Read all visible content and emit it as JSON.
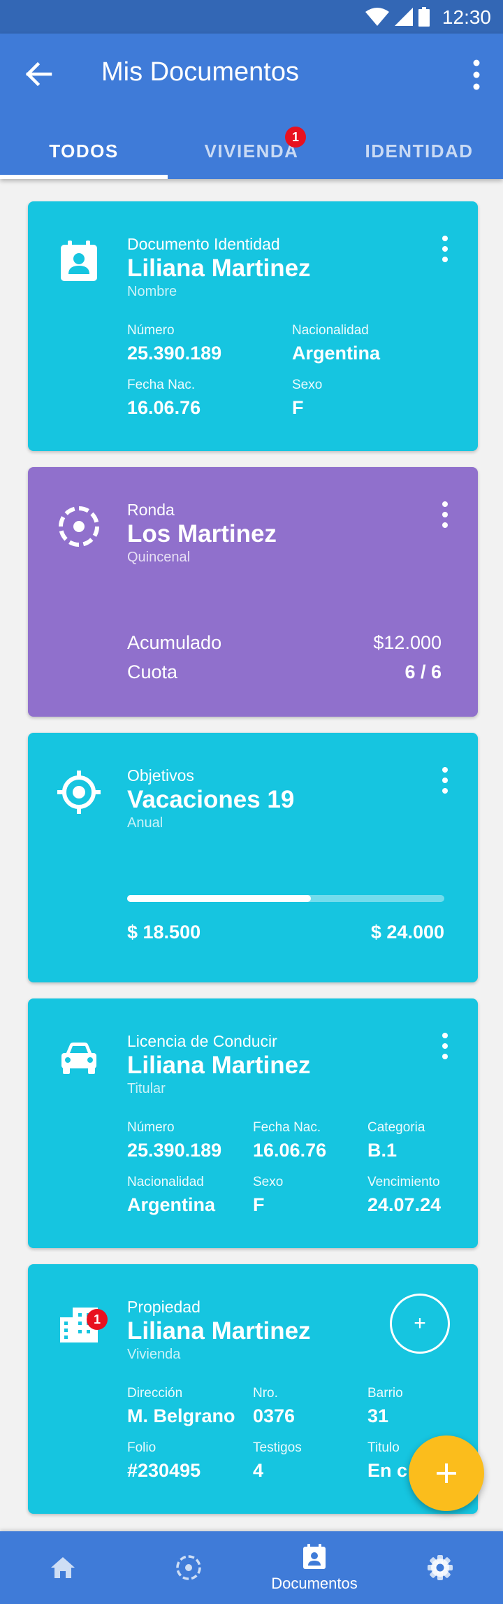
{
  "status_bar": {
    "time": "12:30"
  },
  "app_bar": {
    "title": "Mis Documentos"
  },
  "tabs": [
    {
      "label": "TODOS",
      "active": true
    },
    {
      "label": "VIVIENDA",
      "badge": "1"
    },
    {
      "label": "IDENTIDAD"
    }
  ],
  "cards": {
    "identity": {
      "overline": "Documento Identidad",
      "title": "Liliana Martinez",
      "subtitle": "Nombre",
      "fields": [
        {
          "label": "Número",
          "value": "25.390.189"
        },
        {
          "label": "Nacionalidad",
          "value": "Argentina"
        },
        {
          "label": "Fecha Nac.",
          "value": "16.06.76"
        },
        {
          "label": "Sexo",
          "value": "F"
        }
      ]
    },
    "ronda": {
      "overline": "Ronda",
      "title": "Los Martinez",
      "subtitle": "Quincenal",
      "rows": [
        {
          "label": "Acumulado",
          "value": "$12.000"
        },
        {
          "label": "Cuota",
          "value": "6 / 6"
        }
      ]
    },
    "goal": {
      "overline": "Objetivos",
      "title": "Vacaciones 19",
      "subtitle": "Anual",
      "current": "$ 18.500",
      "target": "$ 24.000",
      "progress": 0.58
    },
    "license": {
      "overline": "Licencia de Conducir",
      "title": "Liliana Martinez",
      "subtitle": "Titular",
      "fields": [
        {
          "label": "Número",
          "value": "25.390.189"
        },
        {
          "label": "Fecha Nac.",
          "value": "16.06.76"
        },
        {
          "label": "Categoria",
          "value": "B.1"
        },
        {
          "label": "Nacionalidad",
          "value": "Argentina"
        },
        {
          "label": "Sexo",
          "value": "F"
        },
        {
          "label": "Vencimiento",
          "value": "24.07.24"
        }
      ]
    },
    "property": {
      "overline": "Propiedad",
      "title": "Liliana Martinez",
      "subtitle": "Vivienda",
      "badge": "1",
      "add_symbol": "+",
      "fields": [
        {
          "label": "Dirección",
          "value": "M. Belgrano"
        },
        {
          "label": "Nro.",
          "value": "0376"
        },
        {
          "label": "Barrio",
          "value": "31"
        },
        {
          "label": "Folio",
          "value": "#230495"
        },
        {
          "label": "Testigos",
          "value": "4"
        },
        {
          "label": "Titulo",
          "value": "En c"
        }
      ]
    }
  },
  "bottom_nav": [
    {
      "icon": "home-icon"
    },
    {
      "icon": "ronda-icon"
    },
    {
      "icon": "documents-icon",
      "label": "Documentos",
      "active": true
    },
    {
      "icon": "settings-icon"
    }
  ],
  "colors": {
    "primary": "#3f7bd8",
    "status_bar": "#3367b5",
    "card_teal": "#16c5e0",
    "card_purple": "#9070cc",
    "fab": "#fbbd1c",
    "badge": "#e8111f"
  }
}
